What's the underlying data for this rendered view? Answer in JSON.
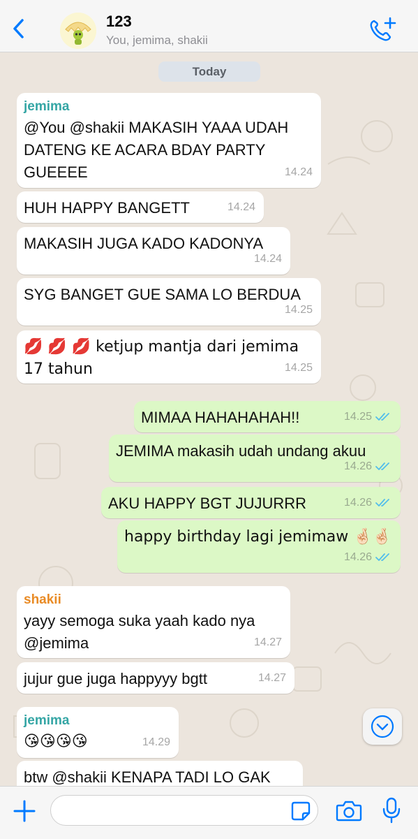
{
  "header": {
    "title": "123",
    "subtitle": "You, jemima, shakii"
  },
  "chat": {
    "day_label": "Today",
    "messages": [
      {
        "sender": "jemima",
        "text": "@You @shakii MAKASIH YAAA UDAH DATENG KE ACARA BDAY PARTY GUEEEE",
        "time": "14.24"
      },
      {
        "text": "HUH HAPPY BANGETT",
        "time": "14.24"
      },
      {
        "text": "MAKASIH JUGA KADO KADONYA",
        "time": "14.24"
      },
      {
        "text": "SYG BANGET GUE SAMA LO BERDUA",
        "time": "14.25"
      },
      {
        "text": "💋 💋 💋  ketjup mantja dari jemima 17 tahun",
        "time": "14.25"
      },
      {
        "text": "MIMAA HAHAHAHAH!!",
        "time": "14.25"
      },
      {
        "text": "JEMIMA makasih udah undang akuu",
        "time": "14.26"
      },
      {
        "text": "AKU HAPPY BGT JUJURRR",
        "time": "14.26"
      },
      {
        "text": "happy birthday lagi jemimaw 🤞🏻🤞🏻",
        "time": "14.26"
      },
      {
        "sender": "shakii",
        "text": "yayy semoga suka yaah kado nya @jemima",
        "time": "14.27"
      },
      {
        "text": "jujur gue juga happyyy bgtt",
        "time": "14.27"
      },
      {
        "sender": "jemima",
        "text": "😘😘😘😘",
        "time": "14.29"
      },
      {
        "text": "btw @shakii KENAPA TADI LO GAK"
      }
    ]
  },
  "colors": {
    "accent": "#007aff",
    "jemima_name": "#35a6a5",
    "shakii_name": "#e98b25",
    "read_ticks": "#53bdeb",
    "outgoing_bubble": "#dcf8c6"
  },
  "icons": {
    "back": "chevron-left-icon",
    "call": "add-call-icon",
    "scroll": "chevron-down-icon",
    "plus": "plus-icon",
    "sticker": "sticker-icon",
    "camera": "camera-icon",
    "mic": "microphone-icon"
  },
  "footer": {
    "input_value": ""
  }
}
